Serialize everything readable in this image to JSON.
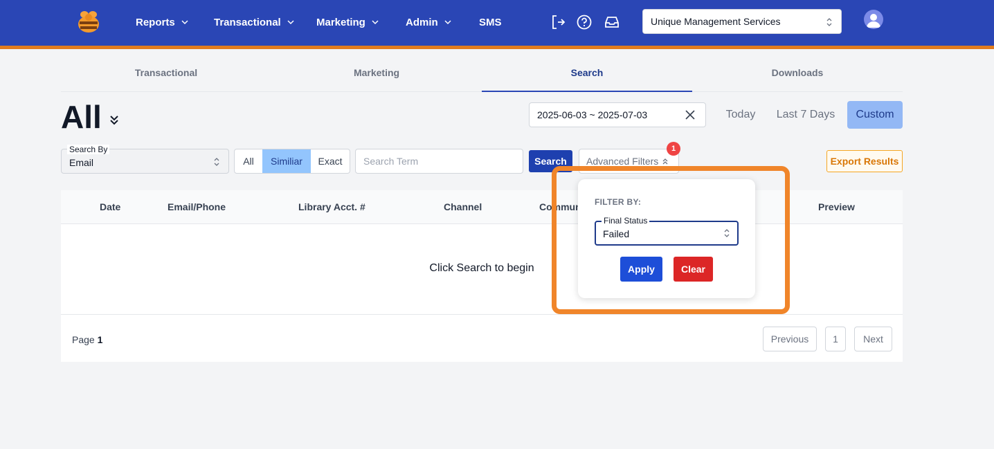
{
  "colors": {
    "nav_bg": "#2a46b5",
    "accent_stripe": "#e07b1f",
    "primary": "#1e40af",
    "danger": "#dc2626",
    "highlight": "#f0852a"
  },
  "nav": {
    "logo_icon": "bee-icon",
    "items": [
      {
        "label": "Reports",
        "has_chevron": true
      },
      {
        "label": "Transactional",
        "has_chevron": true
      },
      {
        "label": "Marketing",
        "has_chevron": true
      },
      {
        "label": "Admin",
        "has_chevron": true
      },
      {
        "label": "SMS",
        "has_chevron": false
      }
    ],
    "icons": [
      "logout-icon",
      "help-icon",
      "inbox-icon"
    ],
    "org_select": "Unique Management Services",
    "avatar_icon": "user-avatar-icon"
  },
  "tabs": [
    {
      "label": "Transactional",
      "active": false
    },
    {
      "label": "Marketing",
      "active": false
    },
    {
      "label": "Search",
      "active": true
    },
    {
      "label": "Downloads",
      "active": false
    }
  ],
  "title": "All",
  "date_range": "2025-06-03 ~ 2025-07-03",
  "range_buttons": {
    "today": "Today",
    "last7": "Last 7 Days",
    "custom": "Custom",
    "selected": "Custom"
  },
  "filters": {
    "search_by_label": "Search By",
    "search_by_value": "Email",
    "match_modes": [
      "All",
      "Similiar",
      "Exact"
    ],
    "match_selected": "Similiar",
    "search_placeholder": "Search Term",
    "search_button": "Search",
    "advanced_filters": "Advanced Filters",
    "advanced_count": "1",
    "export_button": "Export Results"
  },
  "table": {
    "columns": [
      "Date",
      "Email/Phone",
      "Library Acct. #",
      "Channel",
      "Commun",
      "Preview"
    ],
    "empty_message": "Click Search to begin",
    "page_label": "Page",
    "page_number": "1",
    "previous": "Previous",
    "current_page": "1",
    "next": "Next"
  },
  "popover": {
    "heading": "FILTER BY:",
    "final_status_label": "Final Status",
    "final_status_value": "Failed",
    "apply": "Apply",
    "clear": "Clear"
  }
}
